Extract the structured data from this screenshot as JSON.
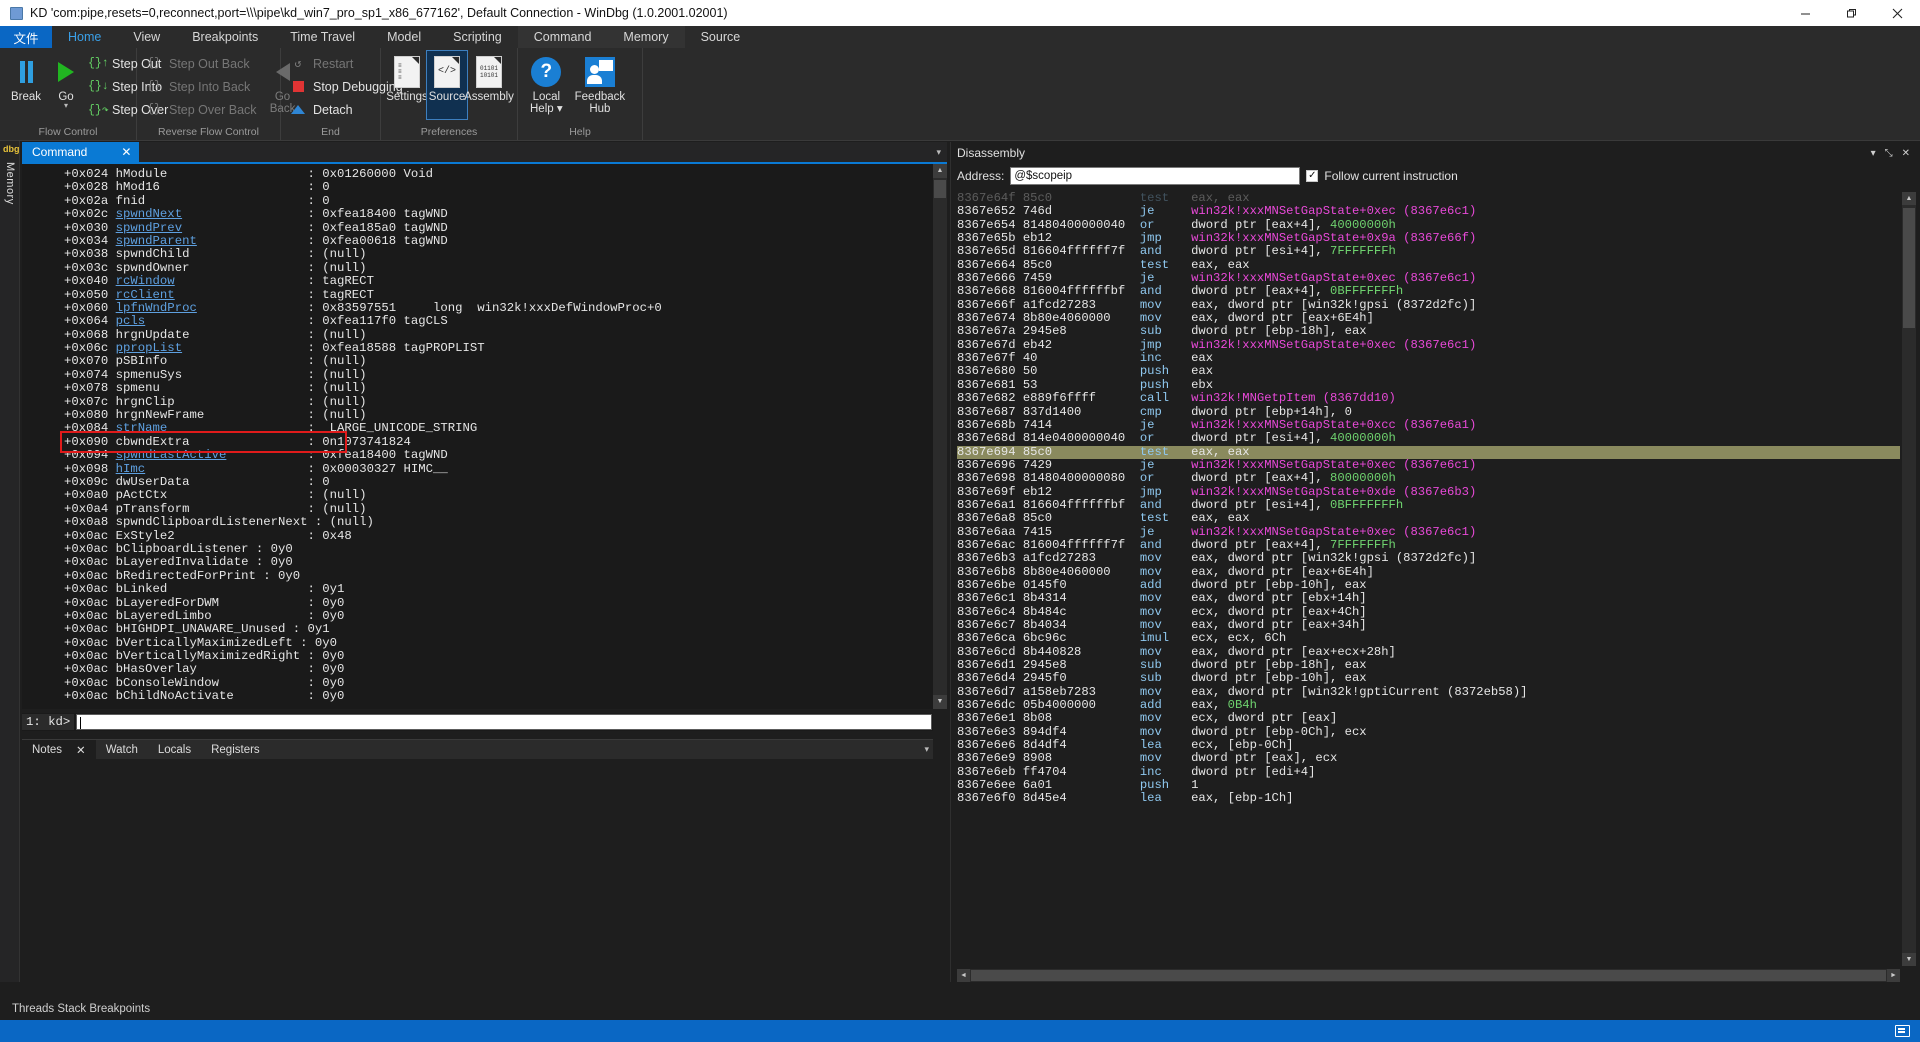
{
  "window": {
    "title": "KD 'com:pipe,resets=0,reconnect,port=\\\\\\pipe\\kd_win7_pro_sp1_x86_677162', Default Connection  - WinDbg (1.0.2001.02001)",
    "minimize": "—",
    "maximize": "☐",
    "restore": "❐",
    "close": "✕"
  },
  "ribbon": {
    "file_tab": "文件",
    "tabs": [
      {
        "label": "Home",
        "active": true
      },
      {
        "label": "View",
        "active": false
      },
      {
        "label": "Breakpoints",
        "active": false
      },
      {
        "label": "Time Travel",
        "active": false
      },
      {
        "label": "Model",
        "active": false
      },
      {
        "label": "Scripting",
        "active": false
      },
      {
        "label": "Command",
        "active": false
      },
      {
        "label": "Memory",
        "active": false
      },
      {
        "label": "Source",
        "active": false
      }
    ],
    "groups": [
      {
        "label": "Flow Control",
        "big": [
          {
            "label": "Break",
            "icon": "pause-icon"
          },
          {
            "label": "Go",
            "icon": "play-icon",
            "dropdown": true
          }
        ],
        "small": [
          {
            "label": "Step Out",
            "icon": "{}",
            "disabled": false
          },
          {
            "label": "Step Into",
            "icon": "{}",
            "disabled": false
          },
          {
            "label": "Step Over",
            "icon": "{}",
            "disabled": false
          }
        ]
      },
      {
        "label": "Reverse Flow Control",
        "small": [
          {
            "label": "Step Out Back",
            "icon": "{}",
            "disabled": true
          },
          {
            "label": "Step Into Back",
            "icon": "{}",
            "disabled": true
          },
          {
            "label": "Step Over Back",
            "icon": "{}",
            "disabled": true
          }
        ],
        "big": [
          {
            "label": "Go\nBack",
            "icon": "back-triangle-icon",
            "disabled": true
          }
        ]
      },
      {
        "label": "End",
        "small": [
          {
            "label": "Restart",
            "icon": "restart-icon",
            "disabled": true
          },
          {
            "label": "Stop Debugging",
            "icon": "stop-square-icon",
            "disabled": false
          },
          {
            "label": "Detach",
            "icon": "eject-icon",
            "disabled": false
          }
        ]
      },
      {
        "label": "Preferences",
        "big": [
          {
            "label": "Settings",
            "icon": "settings-doc-icon"
          },
          {
            "label": "Source",
            "icon": "source-doc-icon",
            "selected": true
          },
          {
            "label": "Assembly",
            "icon": "assembly-doc-icon"
          }
        ]
      },
      {
        "label": "Help",
        "big": [
          {
            "label": "Local\nHelp ▾",
            "icon": "question-circle-icon"
          },
          {
            "label": "Feedback\nHub",
            "icon": "feedback-hub-icon"
          }
        ]
      }
    ]
  },
  "left_rail": {
    "logo": "dbg",
    "item": "Memory"
  },
  "command_panel": {
    "tab_label": "Command",
    "tab_close": "✕",
    "prompt": "1: kd>",
    "input_value": "",
    "bottom_tabs": [
      {
        "label": "Notes",
        "active": true,
        "closable": true,
        "close": "✕"
      },
      {
        "label": "Watch",
        "active": false
      },
      {
        "label": "Locals",
        "active": false
      },
      {
        "label": "Registers",
        "active": false
      }
    ],
    "highlight_color": "#e01b1b",
    "lines": [
      {
        "off": "+0x024",
        "name": "hModule",
        "link": false,
        "val": "0x01260000 Void"
      },
      {
        "off": "+0x028",
        "name": "hMod16",
        "link": false,
        "val": "0"
      },
      {
        "off": "+0x02a",
        "name": "fnid",
        "link": false,
        "val": "0"
      },
      {
        "off": "+0x02c",
        "name": "spwndNext",
        "link": true,
        "val": "0xfea18400 tagWND"
      },
      {
        "off": "+0x030",
        "name": "spwndPrev",
        "link": true,
        "val": "0xfea185a0 tagWND"
      },
      {
        "off": "+0x034",
        "name": "spwndParent",
        "link": true,
        "val": "0xfea00618 tagWND"
      },
      {
        "off": "+0x038",
        "name": "spwndChild",
        "link": false,
        "val": "(null)"
      },
      {
        "off": "+0x03c",
        "name": "spwndOwner",
        "link": false,
        "val": "(null)"
      },
      {
        "off": "+0x040",
        "name": "rcWindow",
        "link": true,
        "val": "tagRECT"
      },
      {
        "off": "+0x050",
        "name": "rcClient",
        "link": true,
        "val": "tagRECT"
      },
      {
        "off": "+0x060",
        "name": "lpfnWndProc",
        "link": true,
        "val": "0x83597551     long  win32k!xxxDefWindowProc+0"
      },
      {
        "off": "+0x064",
        "name": "pcls",
        "link": true,
        "val": "0xfea117f0 tagCLS"
      },
      {
        "off": "+0x068",
        "name": "hrgnUpdate",
        "link": false,
        "val": "(null)"
      },
      {
        "off": "+0x06c",
        "name": "ppropList",
        "link": true,
        "val": "0xfea18588 tagPROPLIST"
      },
      {
        "off": "+0x070",
        "name": "pSBInfo",
        "link": false,
        "val": "(null)"
      },
      {
        "off": "+0x074",
        "name": "spmenuSys",
        "link": false,
        "val": "(null)"
      },
      {
        "off": "+0x078",
        "name": "spmenu",
        "link": false,
        "val": "(null)"
      },
      {
        "off": "+0x07c",
        "name": "hrgnClip",
        "link": false,
        "val": "(null)"
      },
      {
        "off": "+0x080",
        "name": "hrgnNewFrame",
        "link": false,
        "val": "(null)"
      },
      {
        "off": "+0x084",
        "name": "strName",
        "link": true,
        "val": "_LARGE_UNICODE_STRING"
      },
      {
        "off": "+0x090",
        "name": "cbwndExtra",
        "link": false,
        "val": "0n1073741824",
        "highlighted": true
      },
      {
        "off": "+0x094",
        "name": "spwndLastActive",
        "link": true,
        "val": "0xfea18400 tagWND"
      },
      {
        "off": "+0x098",
        "name": "hImc",
        "link": true,
        "val": "0x00030327 HIMC__"
      },
      {
        "off": "+0x09c",
        "name": "dwUserData",
        "link": false,
        "val": "0"
      },
      {
        "off": "+0x0a0",
        "name": "pActCtx",
        "link": false,
        "val": "(null)"
      },
      {
        "off": "+0x0a4",
        "name": "pTransform",
        "link": false,
        "val": "(null)"
      },
      {
        "off": "+0x0a8",
        "name": "spwndClipboardListenerNext : (null)",
        "link": false,
        "val": ""
      },
      {
        "off": "+0x0ac",
        "name": "ExStyle2",
        "link": false,
        "val": "0x48"
      },
      {
        "off": "+0x0ac",
        "name": "bClipboardListener : 0y0",
        "link": false,
        "val": ""
      },
      {
        "off": "+0x0ac",
        "name": "bLayeredInvalidate : 0y0",
        "link": false,
        "val": ""
      },
      {
        "off": "+0x0ac",
        "name": "bRedirectedForPrint : 0y0",
        "link": false,
        "val": ""
      },
      {
        "off": "+0x0ac",
        "name": "bLinked",
        "link": false,
        "val": "0y1"
      },
      {
        "off": "+0x0ac",
        "name": "bLayeredForDWM",
        "link": false,
        "val": "0y0"
      },
      {
        "off": "+0x0ac",
        "name": "bLayeredLimbo",
        "link": false,
        "val": "0y0"
      },
      {
        "off": "+0x0ac",
        "name": "bHIGHDPI_UNAWARE_Unused : 0y1",
        "link": false,
        "val": ""
      },
      {
        "off": "+0x0ac",
        "name": "bVerticallyMaximizedLeft : 0y0",
        "link": false,
        "val": ""
      },
      {
        "off": "+0x0ac",
        "name": "bVerticallyMaximizedRight : 0y0",
        "link": false,
        "val": ""
      },
      {
        "off": "+0x0ac",
        "name": "bHasOverlay",
        "link": false,
        "val": "0y0"
      },
      {
        "off": "+0x0ac",
        "name": "bConsoleWindow",
        "link": false,
        "val": "0y0"
      },
      {
        "off": "+0x0ac",
        "name": "bChildNoActivate",
        "link": false,
        "val": "0y0"
      }
    ]
  },
  "disassembly_panel": {
    "title": "Disassembly",
    "address_label": "Address:",
    "address_value": "@$scopeip",
    "follow_label": "Follow current instruction",
    "follow_checked": true,
    "follow_check_glyph": "✓",
    "header_controls": [
      "▾",
      "⤡",
      "✕"
    ],
    "rows": [
      {
        "addr": "8367e64f",
        "bytes": "85c0",
        "mn": "test",
        "op": "eax, eax",
        "faded": true
      },
      {
        "addr": "8367e652",
        "bytes": "746d",
        "mn": "je",
        "sym": "win32k!xxxMNSetGapState+0xec (8367e6c1)"
      },
      {
        "addr": "8367e654",
        "bytes": "81480400000040",
        "mn": "or",
        "op": "dword ptr [eax+4], ",
        "imm": "40000000h"
      },
      {
        "addr": "8367e65b",
        "bytes": "eb12",
        "mn": "jmp",
        "sym": "win32k!xxxMNSetGapState+0x9a (8367e66f)"
      },
      {
        "addr": "8367e65d",
        "bytes": "816604ffffff7f",
        "mn": "and",
        "op": "dword ptr [esi+4], ",
        "imm": "7FFFFFFFh"
      },
      {
        "addr": "8367e664",
        "bytes": "85c0",
        "mn": "test",
        "op": "eax, eax"
      },
      {
        "addr": "8367e666",
        "bytes": "7459",
        "mn": "je",
        "sym": "win32k!xxxMNSetGapState+0xec (8367e6c1)"
      },
      {
        "addr": "8367e668",
        "bytes": "816004ffffffbf",
        "mn": "and",
        "op": "dword ptr [eax+4], ",
        "imm": "0BFFFFFFFh"
      },
      {
        "addr": "8367e66f",
        "bytes": "a1fcd27283",
        "mn": "mov",
        "op": "eax, dword ptr [win32k!gpsi (8372d2fc)]"
      },
      {
        "addr": "8367e674",
        "bytes": "8b80e4060000",
        "mn": "mov",
        "op": "eax, dword ptr [eax+6E4h]"
      },
      {
        "addr": "8367e67a",
        "bytes": "2945e8",
        "mn": "sub",
        "op": "dword ptr [ebp-18h], eax"
      },
      {
        "addr": "8367e67d",
        "bytes": "eb42",
        "mn": "jmp",
        "sym": "win32k!xxxMNSetGapState+0xec (8367e6c1)"
      },
      {
        "addr": "8367e67f",
        "bytes": "40",
        "mn": "inc",
        "op": "eax"
      },
      {
        "addr": "8367e680",
        "bytes": "50",
        "mn": "push",
        "op": "eax"
      },
      {
        "addr": "8367e681",
        "bytes": "53",
        "mn": "push",
        "op": "ebx"
      },
      {
        "addr": "8367e682",
        "bytes": "e889f6ffff",
        "mn": "call",
        "sym": "win32k!MNGetpItem (8367dd10)"
      },
      {
        "addr": "8367e687",
        "bytes": "837d1400",
        "mn": "cmp",
        "op": "dword ptr [ebp+14h], 0"
      },
      {
        "addr": "8367e68b",
        "bytes": "7414",
        "mn": "je",
        "sym": "win32k!xxxMNSetGapState+0xcc (8367e6a1)"
      },
      {
        "addr": "8367e68d",
        "bytes": "814e0400000040",
        "mn": "or",
        "op": "dword ptr [esi+4], ",
        "imm": "40000000h"
      },
      {
        "addr": "8367e694",
        "bytes": "85c0",
        "mn": "test",
        "op": "eax, eax",
        "current": true
      },
      {
        "addr": "8367e696",
        "bytes": "7429",
        "mn": "je",
        "sym": "win32k!xxxMNSetGapState+0xec (8367e6c1)"
      },
      {
        "addr": "8367e698",
        "bytes": "81480400000080",
        "mn": "or",
        "op": "dword ptr [eax+4], ",
        "imm": "80000000h"
      },
      {
        "addr": "8367e69f",
        "bytes": "eb12",
        "mn": "jmp",
        "sym": "win32k!xxxMNSetGapState+0xde (8367e6b3)"
      },
      {
        "addr": "8367e6a1",
        "bytes": "816604ffffffbf",
        "mn": "and",
        "op": "dword ptr [esi+4], ",
        "imm": "0BFFFFFFFh"
      },
      {
        "addr": "8367e6a8",
        "bytes": "85c0",
        "mn": "test",
        "op": "eax, eax"
      },
      {
        "addr": "8367e6aa",
        "bytes": "7415",
        "mn": "je",
        "sym": "win32k!xxxMNSetGapState+0xec (8367e6c1)"
      },
      {
        "addr": "8367e6ac",
        "bytes": "816004ffffff7f",
        "mn": "and",
        "op": "dword ptr [eax+4], ",
        "imm": "7FFFFFFFh"
      },
      {
        "addr": "8367e6b3",
        "bytes": "a1fcd27283",
        "mn": "mov",
        "op": "eax, dword ptr [win32k!gpsi (8372d2fc)]"
      },
      {
        "addr": "8367e6b8",
        "bytes": "8b80e4060000",
        "mn": "mov",
        "op": "eax, dword ptr [eax+6E4h]"
      },
      {
        "addr": "8367e6be",
        "bytes": "0145f0",
        "mn": "add",
        "op": "dword ptr [ebp-10h], eax"
      },
      {
        "addr": "8367e6c1",
        "bytes": "8b4314",
        "mn": "mov",
        "op": "eax, dword ptr [ebx+14h]"
      },
      {
        "addr": "8367e6c4",
        "bytes": "8b484c",
        "mn": "mov",
        "op": "ecx, dword ptr [eax+4Ch]"
      },
      {
        "addr": "8367e6c7",
        "bytes": "8b4034",
        "mn": "mov",
        "op": "eax, dword ptr [eax+34h]"
      },
      {
        "addr": "8367e6ca",
        "bytes": "6bc96c",
        "mn": "imul",
        "op": "ecx, ecx, 6Ch"
      },
      {
        "addr": "8367e6cd",
        "bytes": "8b440828",
        "mn": "mov",
        "op": "eax, dword ptr [eax+ecx+28h]"
      },
      {
        "addr": "8367e6d1",
        "bytes": "2945e8",
        "mn": "sub",
        "op": "dword ptr [ebp-18h], eax"
      },
      {
        "addr": "8367e6d4",
        "bytes": "2945f0",
        "mn": "sub",
        "op": "dword ptr [ebp-10h], eax"
      },
      {
        "addr": "8367e6d7",
        "bytes": "a158eb7283",
        "mn": "mov",
        "op": "eax, dword ptr [win32k!gptiCurrent (8372eb58)]"
      },
      {
        "addr": "8367e6dc",
        "bytes": "05b4000000",
        "mn": "add",
        "op": "eax, ",
        "imm": "0B4h"
      },
      {
        "addr": "8367e6e1",
        "bytes": "8b08",
        "mn": "mov",
        "op": "ecx, dword ptr [eax]"
      },
      {
        "addr": "8367e6e3",
        "bytes": "894df4",
        "mn": "mov",
        "op": "dword ptr [ebp-0Ch], ecx"
      },
      {
        "addr": "8367e6e6",
        "bytes": "8d4df4",
        "mn": "lea",
        "op": "ecx, [ebp-0Ch]"
      },
      {
        "addr": "8367e6e9",
        "bytes": "8908",
        "mn": "mov",
        "op": "dword ptr [eax], ecx"
      },
      {
        "addr": "8367e6eb",
        "bytes": "ff4704",
        "mn": "inc",
        "op": "dword ptr [edi+4]"
      },
      {
        "addr": "8367e6ee",
        "bytes": "6a01",
        "mn": "push",
        "op": "1"
      },
      {
        "addr": "8367e6f0",
        "bytes": "8d45e4",
        "mn": "lea",
        "op": "eax, [ebp-1Ch]"
      }
    ]
  },
  "status_bar": {
    "text": "Threads Stack Breakpoints"
  },
  "taskbar": {
    "notification_icon": "notification-bell-icon"
  }
}
